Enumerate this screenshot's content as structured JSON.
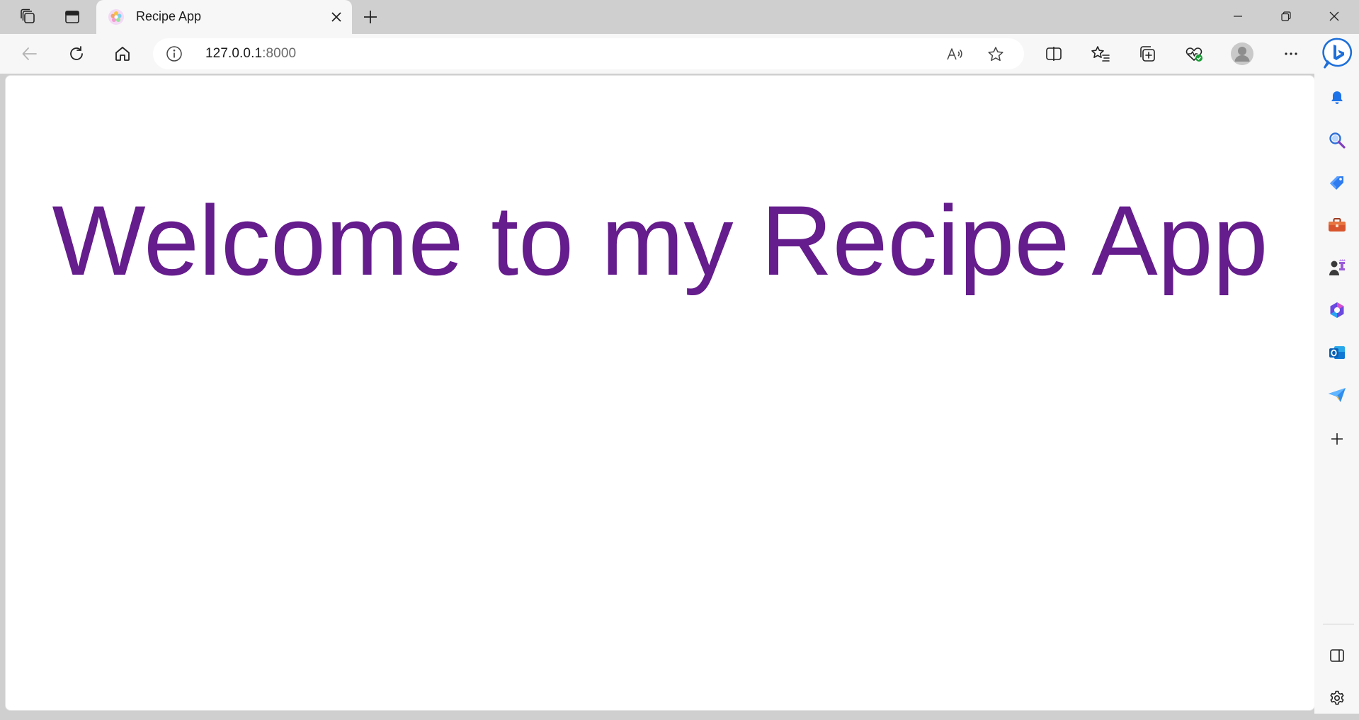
{
  "tab": {
    "title": "Recipe App",
    "favicon": "recipe-app-favicon"
  },
  "address_bar": {
    "host": "127.0.0.1",
    "port": ":8000",
    "icon": "info-icon"
  },
  "page": {
    "heading": "Welcome to my Recipe App",
    "heading_color": "#651c8c"
  },
  "toolbar_icons": [
    "back-icon",
    "refresh-icon",
    "home-icon",
    "read-aloud-icon",
    "favorite-star-icon",
    "split-screen-icon",
    "favorites-icon",
    "collections-icon",
    "browser-essentials-icon",
    "profile-avatar",
    "more-icon",
    "copilot-icon"
  ],
  "sidebar_icons": [
    "notifications-icon",
    "search-icon",
    "shopping-icon",
    "tools-icon",
    "games-icon",
    "microsoft-365-icon",
    "outlook-icon",
    "drop-icon",
    "add-icon",
    "hide-sidebar-icon",
    "settings-icon"
  ]
}
